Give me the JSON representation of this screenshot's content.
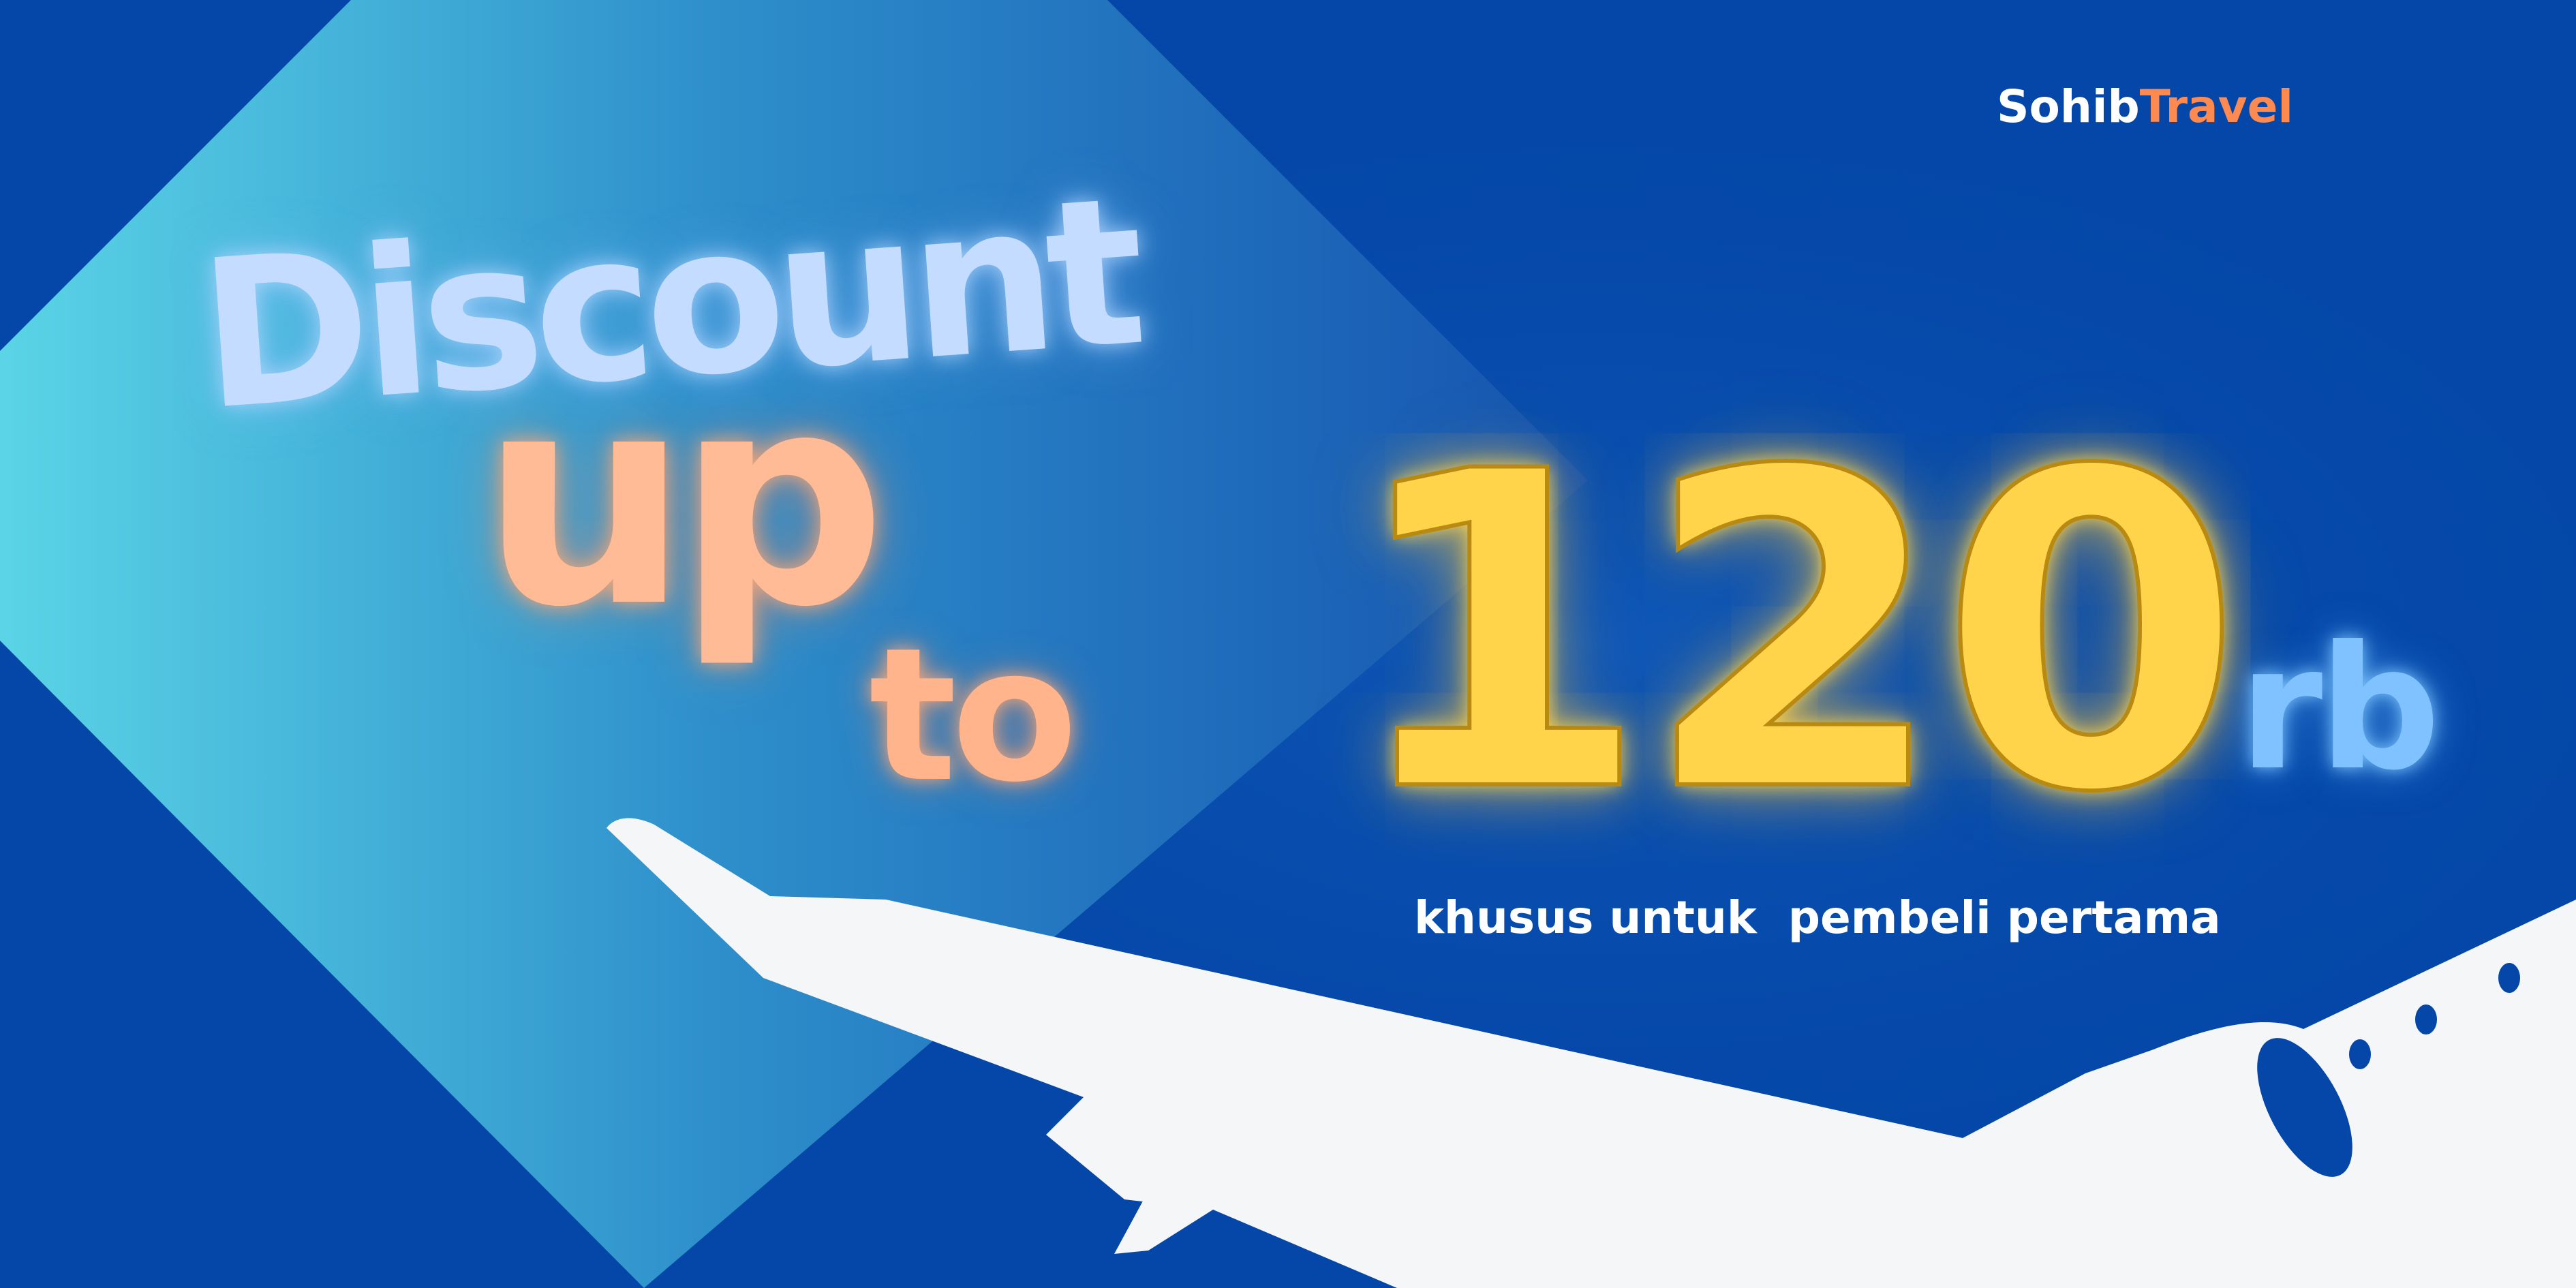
{
  "brand": {
    "part_1": "Sohib",
    "part_2": "Travel",
    "color_primary": "#ffffff",
    "color_accent": "#ff8a50"
  },
  "promo": {
    "word_discount": "Discount",
    "word_up": "up",
    "word_to": "to",
    "amount": "120",
    "unit": "rb",
    "tagline": "khusus untuk  pembeli pertama"
  },
  "colors": {
    "background": "#0447a8",
    "panel_light": "#5ad4e6",
    "panel_dark": "#1a63bf",
    "discount_text": "#c3dcff",
    "up_to_text": "#ffbb95",
    "amount_text": "#ffd34a",
    "unit_text": "#7fc2ff",
    "airplane": "#f4f6f8"
  },
  "graphics": {
    "airplane": "airplane-silhouette"
  }
}
